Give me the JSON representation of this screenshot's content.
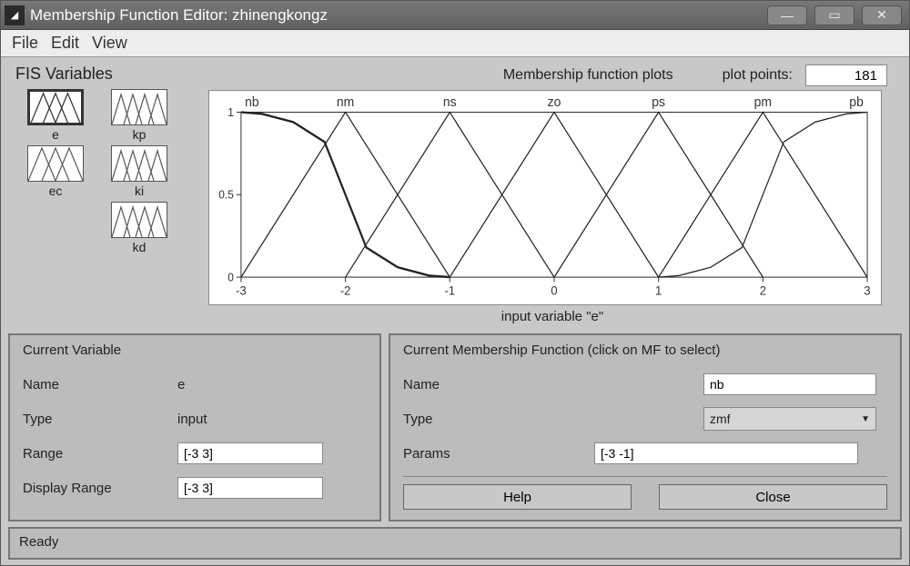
{
  "window": {
    "title": "Membership Function Editor: zhinengkongz"
  },
  "menu": {
    "file": "File",
    "edit": "Edit",
    "view": "View"
  },
  "fis": {
    "heading": "FIS Variables",
    "items": [
      {
        "name": "e",
        "selected": true
      },
      {
        "name": "kp",
        "selected": false
      },
      {
        "name": "ec",
        "selected": false
      },
      {
        "name": "ki",
        "selected": false
      },
      {
        "name": "",
        "selected": false
      },
      {
        "name": "kd",
        "selected": false
      }
    ]
  },
  "plot": {
    "label": "Membership function plots",
    "points_label": "plot points:",
    "points_value": "181",
    "mf_labels": [
      "nb",
      "nm",
      "ns",
      "zo",
      "ps",
      "pm",
      "pb"
    ],
    "xticks": [
      "-3",
      "-2",
      "-1",
      "0",
      "1",
      "2",
      "3"
    ],
    "yticks": [
      "0",
      "0.5",
      "1"
    ],
    "xlabel": "input variable \"e\""
  },
  "chart_data": {
    "type": "line",
    "title": "Membership function plots",
    "xlabel": "input variable \"e\"",
    "ylabel": "",
    "xlim": [
      -3,
      3
    ],
    "ylim": [
      0,
      1
    ],
    "series": [
      {
        "name": "nb",
        "type": "zmf",
        "x": [
          -3.0,
          -2.8,
          -2.5,
          -2.2,
          -2.0,
          -1.8,
          -1.5,
          -1.2,
          -1.0
        ],
        "y": [
          1.0,
          0.99,
          0.94,
          0.82,
          0.5,
          0.18,
          0.06,
          0.01,
          0.0
        ]
      },
      {
        "name": "nm",
        "type": "trimf",
        "x": [
          -3,
          -2,
          -1
        ],
        "y": [
          0,
          1,
          0
        ]
      },
      {
        "name": "ns",
        "type": "trimf",
        "x": [
          -2,
          -1,
          0
        ],
        "y": [
          0,
          1,
          0
        ]
      },
      {
        "name": "zo",
        "type": "trimf",
        "x": [
          -1,
          0,
          1
        ],
        "y": [
          0,
          1,
          0
        ]
      },
      {
        "name": "ps",
        "type": "trimf",
        "x": [
          0,
          1,
          2
        ],
        "y": [
          0,
          1,
          0
        ]
      },
      {
        "name": "pm",
        "type": "trimf",
        "x": [
          1,
          2,
          3
        ],
        "y": [
          0,
          1,
          0
        ]
      },
      {
        "name": "pb",
        "type": "smf",
        "x": [
          1.0,
          1.2,
          1.5,
          1.8,
          2.0,
          2.2,
          2.5,
          2.8,
          3.0
        ],
        "y": [
          0.0,
          0.01,
          0.06,
          0.18,
          0.5,
          0.82,
          0.94,
          0.99,
          1.0
        ]
      }
    ]
  },
  "cur_var": {
    "title": "Current Variable",
    "name_label": "Name",
    "name_value": "e",
    "type_label": "Type",
    "type_value": "input",
    "range_label": "Range",
    "range_value": "[-3 3]",
    "drange_label": "Display Range",
    "drange_value": "[-3 3]"
  },
  "cur_mf": {
    "title": "Current Membership Function (click on MF to select)",
    "name_label": "Name",
    "name_value": "nb",
    "type_label": "Type",
    "type_value": "zmf",
    "params_label": "Params",
    "params_value": "[-3 -1]",
    "help": "Help",
    "close": "Close"
  },
  "status": "Ready"
}
